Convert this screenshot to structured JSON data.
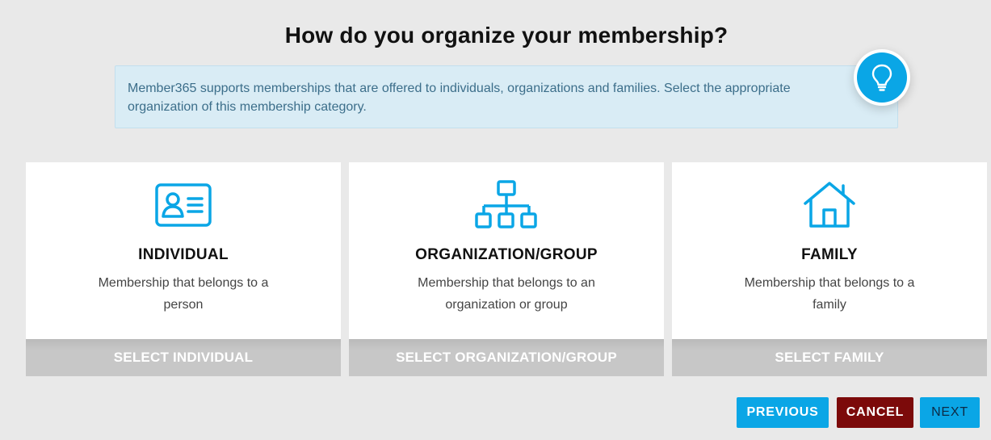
{
  "page": {
    "title": "How do you organize your membership?"
  },
  "info": {
    "text": "Member365 supports memberships that are offered to individuals, organizations and families. Select the appropriate organization of this membership category.",
    "icon": "lightbulb-icon"
  },
  "cards": [
    {
      "icon": "id-card-icon",
      "title": "INDIVIDUAL",
      "desc": "Membership that belongs to a person",
      "button": "SELECT INDIVIDUAL"
    },
    {
      "icon": "org-chart-icon",
      "title": "ORGANIZATION/GROUP",
      "desc": "Membership that belongs to an organization or group",
      "button": "SELECT ORGANIZATION/GROUP"
    },
    {
      "icon": "house-icon",
      "title": "FAMILY",
      "desc": "Membership that belongs to a family",
      "button": "SELECT FAMILY"
    }
  ],
  "nav": {
    "previous": "PREVIOUS",
    "cancel": "CANCEL",
    "next": "NEXT"
  },
  "colors": {
    "accent": "#0aa6e6",
    "cancel": "#7c0a0a",
    "select_button": "#c7c7c7",
    "info_background": "#d9ecf5"
  }
}
